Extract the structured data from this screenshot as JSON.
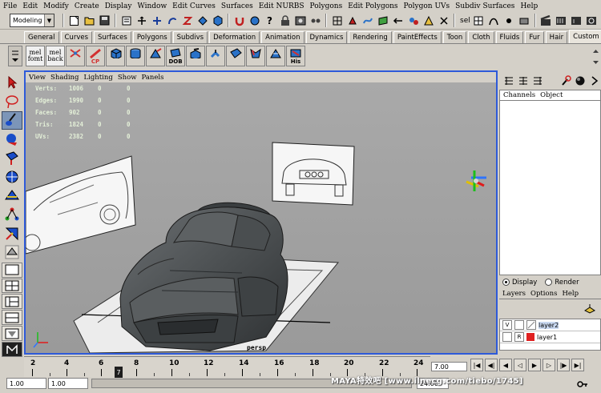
{
  "menubar": [
    "File",
    "Edit",
    "Modify",
    "Create",
    "Display",
    "Window",
    "Edit Curves",
    "Surfaces",
    "Edit NURBS",
    "Polygons",
    "Edit Polygons",
    "Polygon UVs",
    "Subdiv Surfaces",
    "Help"
  ],
  "statusline": {
    "mode": "Modeling",
    "sel_label": "sel",
    "icons": [
      "new-scene-icon",
      "open-scene-icon",
      "save-scene-icon",
      "select-hierarchy-icon",
      "select-object-icon",
      "select-component-icon",
      "snap-grid-icon",
      "snap-curve-icon",
      "snap-point-icon",
      "snap-plane-icon",
      "history-icon",
      "render-icon",
      "ipr-render-icon",
      "render-globals-icon"
    ]
  },
  "shelf_tabs": [
    "General",
    "Curves",
    "Surfaces",
    "Polygons",
    "Subdivs",
    "Deformation",
    "Animation",
    "Dynamics",
    "Rendering",
    "PaintEffects",
    "Toon",
    "Cloth",
    "Fluids",
    "Fur",
    "Hair",
    "Custom"
  ],
  "shelf_active_tab": "Custom",
  "shelf": {
    "buttons": [
      {
        "name": "mel-fomt",
        "line1": "mel",
        "line2": "fomt",
        "kind": "mel"
      },
      {
        "name": "mel-back",
        "line1": "mel",
        "line2": "back",
        "kind": "mel"
      },
      {
        "name": "mirror-tool",
        "caption": "",
        "color": "#d23030"
      },
      {
        "name": "cp-tool",
        "caption": "CP",
        "color": "#d23030"
      },
      {
        "name": "cube-tool",
        "caption": "",
        "color": "#2a72c8"
      },
      {
        "name": "cylinder-tool",
        "caption": "",
        "color": "#2a72c8"
      },
      {
        "name": "smooth-tool",
        "caption": "",
        "color": "#2a72c8"
      },
      {
        "name": "dob-tool",
        "caption": "DOB",
        "color": "#2a72c8"
      },
      {
        "name": "extrude-tool",
        "caption": "",
        "color": "#2a72c8"
      },
      {
        "name": "split-tool",
        "caption": "",
        "color": "#2a72c8"
      },
      {
        "name": "wedge-tool",
        "caption": "",
        "color": "#2a72c8"
      },
      {
        "name": "merge-tool",
        "caption": "",
        "color": "#2a72c8"
      },
      {
        "name": "pyramid-tool",
        "caption": "",
        "color": "#2a72c8"
      },
      {
        "name": "his-tool",
        "caption": "His",
        "color": "#2a72c8"
      }
    ]
  },
  "viewport": {
    "menu": [
      "View",
      "Shading",
      "Lighting",
      "Show",
      "Panels"
    ],
    "hud": [
      {
        "label": "Verts:",
        "values": [
          "1006",
          "0",
          "0"
        ]
      },
      {
        "label": "Edges:",
        "values": [
          "1990",
          "0",
          "0"
        ]
      },
      {
        "label": "Faces:",
        "values": [
          "902",
          "0",
          "0"
        ]
      },
      {
        "label": "Tris:",
        "values": [
          "1824",
          "0",
          "0"
        ]
      },
      {
        "label": "UVs:",
        "values": [
          "2382",
          "0",
          "0"
        ]
      }
    ],
    "camera_label": "persp"
  },
  "channel_box": {
    "menu": [
      "Channels",
      "Object"
    ]
  },
  "layer_editor": {
    "display_label": "Display",
    "render_label": "Render",
    "display_mode": "Display",
    "menu": [
      "Layers",
      "Options",
      "Help"
    ],
    "layers": [
      {
        "name": "layer2",
        "visibility": "V",
        "render": "",
        "color": "",
        "selected": true
      },
      {
        "name": "layer1",
        "visibility": "",
        "render": "R",
        "color": "#e02020",
        "selected": false
      }
    ]
  },
  "timeline": {
    "ticks": [
      "2",
      "4",
      "6",
      "8",
      "10",
      "12",
      "14",
      "16",
      "18",
      "20",
      "22",
      "24"
    ],
    "current_frame": "7",
    "current_time": "7.00",
    "playback": [
      "go-to-start",
      "step-back-key",
      "step-back",
      "play-back",
      "play-forward",
      "step-forward",
      "step-forward-key",
      "go-to-end"
    ]
  },
  "range": {
    "start": "1.00",
    "playback_start": "1.00",
    "end": "24.00"
  },
  "watermark": "MAYA特效吧 [www.ilnecg.com/tiebo/1745]"
}
